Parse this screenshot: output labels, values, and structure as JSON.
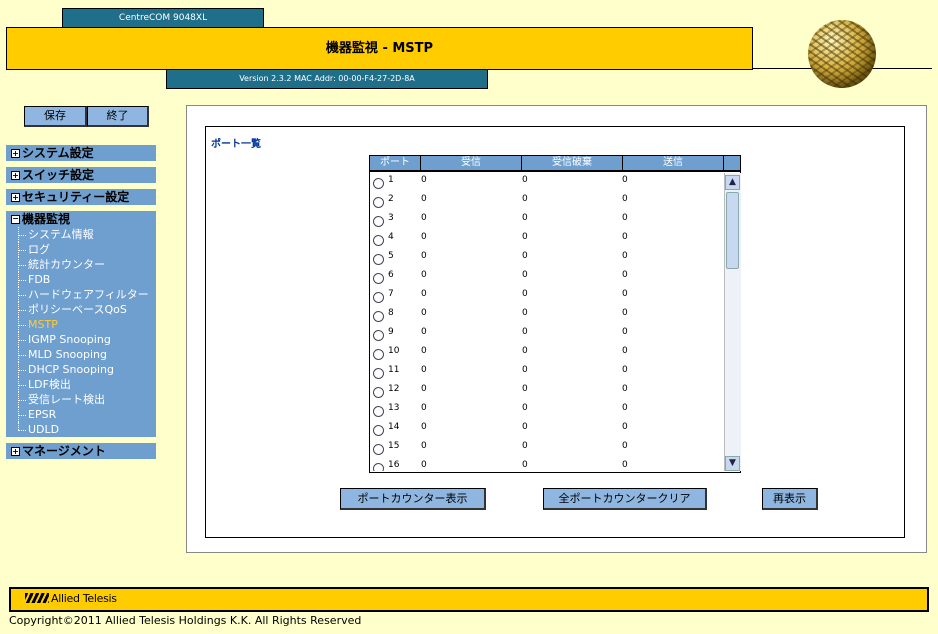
{
  "header": {
    "model": "CentreCOM 9048XL",
    "title": "機器監視 - MSTP",
    "version": "Version 2.3.2 MAC Addr: 00-00-F4-27-2D-8A"
  },
  "toolbar": {
    "save_label": "保存",
    "exit_label": "終了"
  },
  "sidebar": {
    "system": "システム設定",
    "switch": "スイッチ設定",
    "security": "セキュリティー設定",
    "monitor": "機器監視",
    "monitor_items": [
      "システム情報",
      "ログ",
      "統計カウンター",
      "FDB",
      "ハードウェアフィルター",
      "ポリシーベースQoS",
      "MSTP",
      "IGMP Snooping",
      "MLD Snooping",
      "DHCP Snooping",
      "LDF検出",
      "受信レート検出",
      "EPSR",
      "UDLD"
    ],
    "active_item": "MSTP",
    "management": "マネージメント",
    "expand_symbol": "+",
    "collapse_symbol": "−"
  },
  "main": {
    "section_title": "ポート一覧",
    "columns": {
      "port": "ポート",
      "rx": "受信",
      "rx_discard": "受信破棄",
      "tx": "送信"
    },
    "rows": [
      {
        "port": "1",
        "rx": "0",
        "rx_discard": "0",
        "tx": "0"
      },
      {
        "port": "2",
        "rx": "0",
        "rx_discard": "0",
        "tx": "0"
      },
      {
        "port": "3",
        "rx": "0",
        "rx_discard": "0",
        "tx": "0"
      },
      {
        "port": "4",
        "rx": "0",
        "rx_discard": "0",
        "tx": "0"
      },
      {
        "port": "5",
        "rx": "0",
        "rx_discard": "0",
        "tx": "0"
      },
      {
        "port": "6",
        "rx": "0",
        "rx_discard": "0",
        "tx": "0"
      },
      {
        "port": "7",
        "rx": "0",
        "rx_discard": "0",
        "tx": "0"
      },
      {
        "port": "8",
        "rx": "0",
        "rx_discard": "0",
        "tx": "0"
      },
      {
        "port": "9",
        "rx": "0",
        "rx_discard": "0",
        "tx": "0"
      },
      {
        "port": "10",
        "rx": "0",
        "rx_discard": "0",
        "tx": "0"
      },
      {
        "port": "11",
        "rx": "0",
        "rx_discard": "0",
        "tx": "0"
      },
      {
        "port": "12",
        "rx": "0",
        "rx_discard": "0",
        "tx": "0"
      },
      {
        "port": "13",
        "rx": "0",
        "rx_discard": "0",
        "tx": "0"
      },
      {
        "port": "14",
        "rx": "0",
        "rx_discard": "0",
        "tx": "0"
      },
      {
        "port": "15",
        "rx": "0",
        "rx_discard": "0",
        "tx": "0"
      },
      {
        "port": "16",
        "rx": "0",
        "rx_discard": "0",
        "tx": "0"
      }
    ],
    "buttons": {
      "port_counter": "ポートカウンター表示",
      "clear_all": "全ポートカウンタークリア",
      "refresh": "再表示"
    }
  },
  "scrollbar": {
    "up": "▲",
    "down": "▼"
  },
  "footer": {
    "logo_text": "Allied Telesis",
    "copyright": "Copyright©2011 Allied Telesis Holdings K.K. All Rights Reserved"
  },
  "colors": {
    "background": "#ffffcc",
    "title_bar": "#ffcc00",
    "tab": "#1f6f8b",
    "menu": "#6f9fcf",
    "active_item": "#ffcc33",
    "section_title": "#003399"
  },
  "icons": {
    "globe": "globe-logo",
    "brand": "allied-telesis-logo"
  }
}
